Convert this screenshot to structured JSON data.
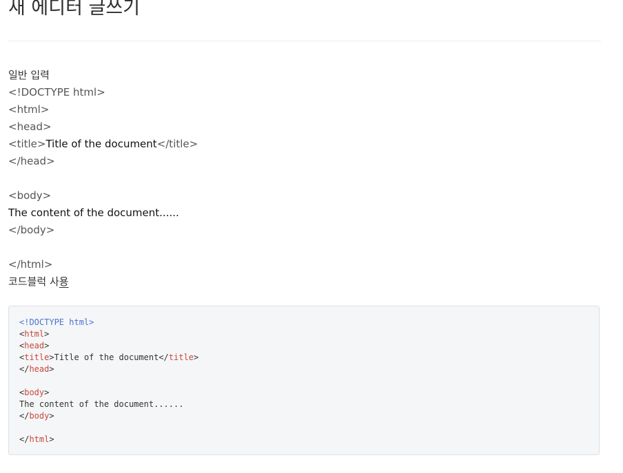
{
  "page": {
    "title": "새 에디터 글쓰기"
  },
  "plain_section": {
    "label": "일반 입력",
    "lines": [
      "<!DOCTYPE html>",
      "<html>",
      "<head>",
      "<title>",
      "Title of the document",
      "</title>",
      "</head>",
      "<body>",
      "The content of the document......",
      "</body>",
      "</html>"
    ]
  },
  "code_section": {
    "label_main": "코드블럭 사",
    "label_underlined": "용",
    "code": {
      "doctype": "<!DOCTYPE html>",
      "html": "html",
      "head": "head",
      "title": "title",
      "title_text": "Title of the document",
      "body": "body",
      "body_text": "The content of the document......",
      "lt": "<",
      "gt": ">",
      "close": "</"
    }
  },
  "colors": {
    "doctype": "#4a72d4",
    "tagname": "#c9463d",
    "code_bg": "#f5f6f7"
  }
}
